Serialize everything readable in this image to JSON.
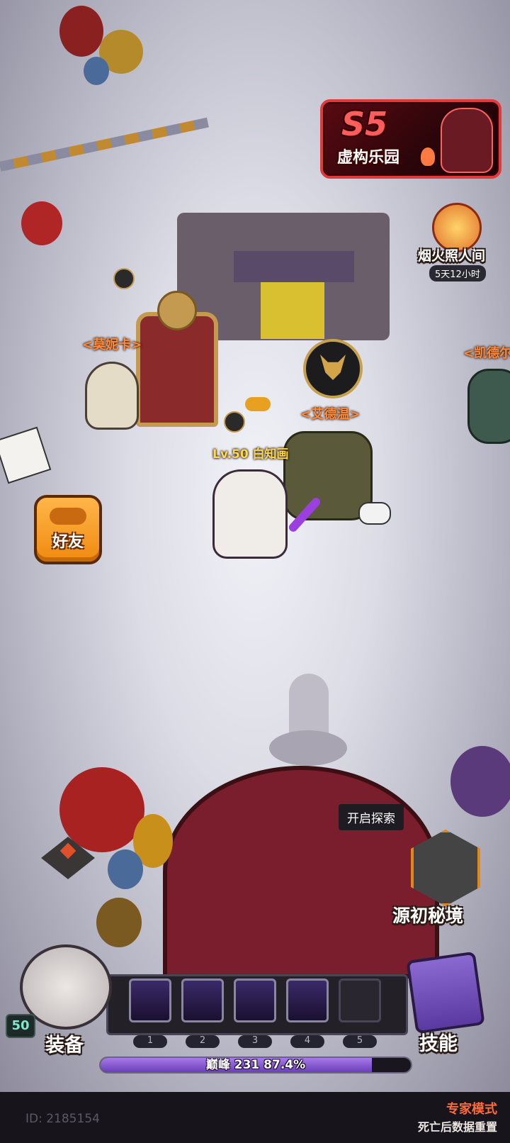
{
  "season": {
    "code": "S5",
    "name": "虚构乐园"
  },
  "event": {
    "title": "烟火照人间",
    "timer": "5天12小时"
  },
  "npcs": {
    "monica": "<莫妮卡>",
    "edwin": "<艾德温>",
    "kaide": "<凯德尔"
  },
  "player": {
    "label": "Lv.50 白知画",
    "level": "50"
  },
  "friends_button": {
    "label": "好友"
  },
  "explore": {
    "tooltip": "开启探索",
    "label": "源初秘境"
  },
  "equip": {
    "label": "装备"
  },
  "skills": {
    "label": "技能",
    "slots": [
      "1",
      "2",
      "3",
      "4",
      "5"
    ]
  },
  "progress": {
    "text": "巅峰 231  87.4%",
    "percent": 87.4
  },
  "footer": {
    "id": "ID: 2185154",
    "mode": "专家模式",
    "mode_note": "死亡后数据重置"
  },
  "colors": {
    "accent": "#ff8a3a",
    "name_yellow": "#ffd94a",
    "season_red": "#e23a3a",
    "xp_purple": "#8a5cd6"
  }
}
